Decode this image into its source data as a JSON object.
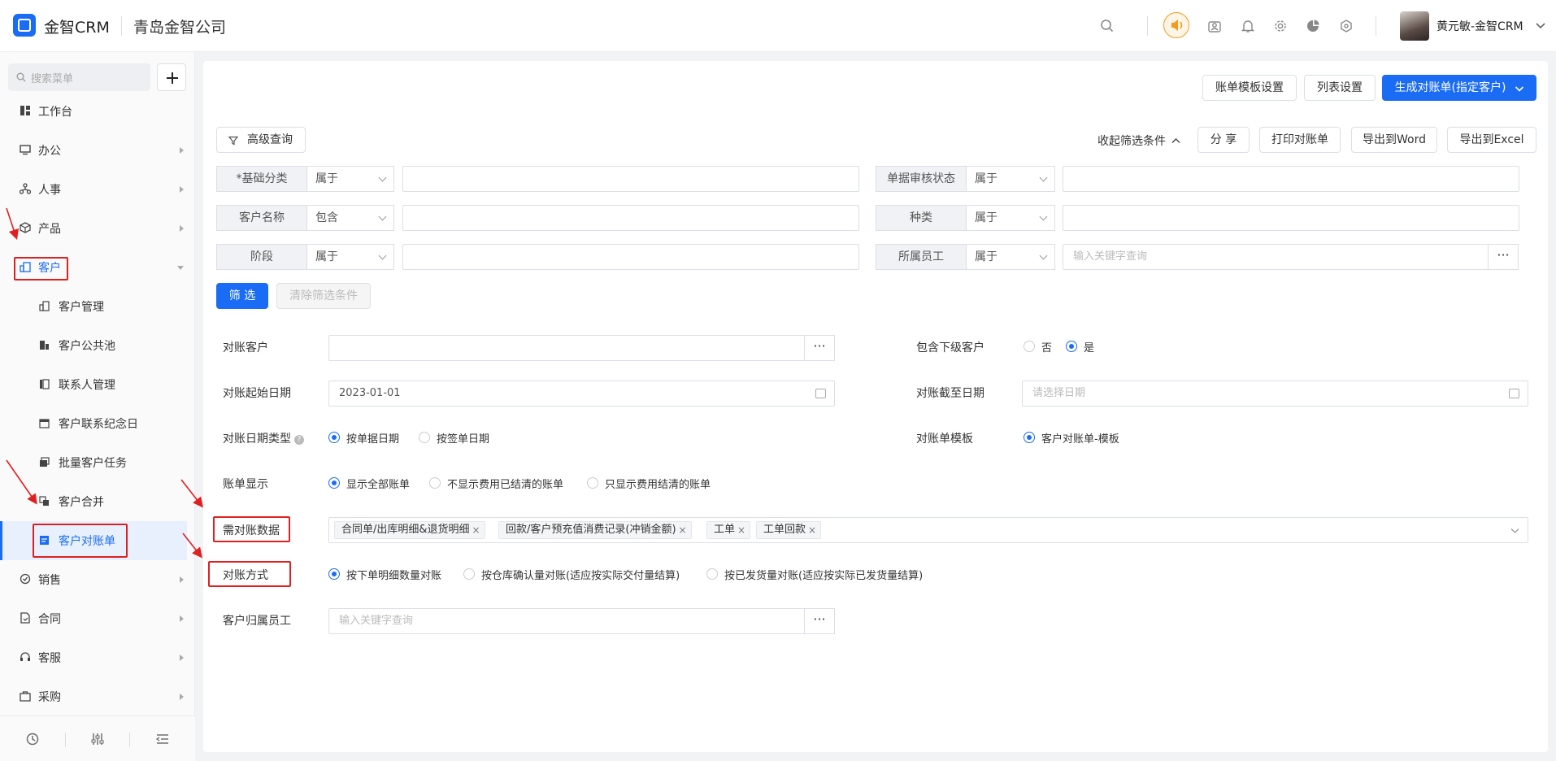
{
  "header": {
    "brand": "金智CRM",
    "company": "青岛金智公司",
    "user": "黄元敏-金智CRM",
    "icons": [
      "search-icon",
      "notice-icon",
      "contacts-icon",
      "bell-icon",
      "gear-icon",
      "chart-icon",
      "shield-icon",
      "dropdown-icon"
    ],
    "accent": "#1a6cf5"
  },
  "sidebar": {
    "search_placeholder": "搜索菜单",
    "menu": [
      {
        "label": "工作台"
      },
      {
        "label": "办公"
      },
      {
        "label": "人事"
      },
      {
        "label": "产品"
      },
      {
        "label": "客户"
      },
      {
        "label": "销售"
      },
      {
        "label": "合同"
      },
      {
        "label": "客服"
      },
      {
        "label": "采购"
      }
    ],
    "customer_sub": [
      {
        "label": "客户管理"
      },
      {
        "label": "客户公共池"
      },
      {
        "label": "联系人管理"
      },
      {
        "label": "客户联系纪念日"
      },
      {
        "label": "批量客户任务"
      },
      {
        "label": "客户合并"
      },
      {
        "label": "客户对账单"
      }
    ],
    "active_item": "客户对账单"
  },
  "toolbar": {
    "template_settings": "账单模板设置",
    "list_settings": "列表设置",
    "generate": "生成对账单(指定客户)",
    "advanced_query": "高级查询",
    "collapse_filter": "收起筛选条件",
    "share": "分 享",
    "print": "打印对账单",
    "export_word": "导出到Word",
    "export_excel": "导出到Excel"
  },
  "filters": {
    "rows": [
      {
        "label": "*基础分类",
        "op": "属于",
        "value": ""
      },
      {
        "label": "客户名称",
        "op": "包含",
        "value": ""
      },
      {
        "label": "阶段",
        "op": "属于",
        "value": ""
      },
      {
        "label": "单据审核状态",
        "op": "属于",
        "value": ""
      },
      {
        "label": "种类",
        "op": "属于",
        "value": ""
      },
      {
        "label": "所属员工",
        "op": "属于",
        "placeholder": "输入关键字查询"
      }
    ],
    "filter_btn": "筛 选",
    "clear_btn": "清除筛选条件"
  },
  "form": {
    "customer": {
      "label": "对账客户",
      "value": ""
    },
    "include_sub": {
      "label": "包含下级客户",
      "options": [
        "否",
        "是"
      ],
      "selected": "是"
    },
    "start_date": {
      "label": "对账起始日期",
      "value": "2023-01-01"
    },
    "end_date": {
      "label": "对账截至日期",
      "placeholder": "请选择日期"
    },
    "date_type": {
      "label": "对账日期类型",
      "options": [
        "按单据日期",
        "按签单日期"
      ],
      "selected": "按单据日期"
    },
    "template": {
      "label": "对账单模板",
      "options": [
        "客户对账单-模板"
      ],
      "selected": "客户对账单-模板"
    },
    "display": {
      "label": "账单显示",
      "options": [
        "显示全部账单",
        "不显示费用已结清的账单",
        "只显示费用结清的账单"
      ],
      "selected": "显示全部账单"
    },
    "data": {
      "label": "需对账数据",
      "tags": [
        "合同单/出库明细&退货明细",
        "回款/客户预充值消费记录(冲销金额)",
        "工单",
        "工单回款"
      ]
    },
    "method": {
      "label": "对账方式",
      "options": [
        "按下单明细数量对账",
        "按仓库确认量对账(适应按实际交付量结算)",
        "按已发货量对账(适应按实际已发货量结算)"
      ],
      "selected": "按下单明细数量对账"
    },
    "owner": {
      "label": "客户归属员工",
      "placeholder": "输入关键字查询"
    }
  },
  "annotation_color": "#e02020"
}
